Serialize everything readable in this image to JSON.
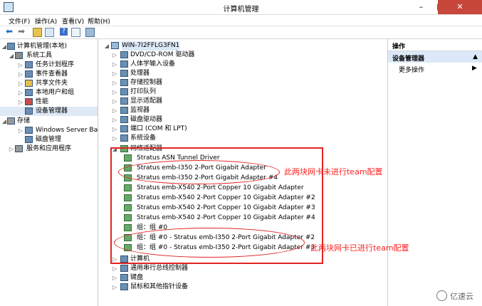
{
  "window": {
    "title": "计算机管理",
    "minimize": "–",
    "maximize": "□",
    "close": "✕"
  },
  "menu": [
    "文件(F)",
    "操作(A)",
    "查看(V)",
    "帮助(H)"
  ],
  "toolbar": [
    "back-icon",
    "forward-icon",
    "up-icon",
    "properties-icon",
    "help-icon",
    "view-icon",
    "monitor-icon"
  ],
  "left_tree": [
    {
      "label": "计算机管理(本地)",
      "level": 0,
      "expanded": true
    },
    {
      "label": "系统工具",
      "level": 1,
      "expanded": true
    },
    {
      "label": "任务计划程序",
      "level": 2
    },
    {
      "label": "事件查看器",
      "level": 2
    },
    {
      "label": "共享文件夹",
      "level": 2
    },
    {
      "label": "本地用户和组",
      "level": 2
    },
    {
      "label": "性能",
      "level": 2
    },
    {
      "label": "设备管理器",
      "level": 2,
      "selected": true
    },
    {
      "label": "存储",
      "level": 1,
      "expanded": true
    },
    {
      "label": "Windows Server Back",
      "level": 2
    },
    {
      "label": "磁盘管理",
      "level": 2
    },
    {
      "label": "服务和应用程序",
      "level": 1
    }
  ],
  "center": {
    "computer": "WIN-7I2FFLG3FN1",
    "categories": [
      "DVD/CD-ROM 驱动器",
      "人体学输入设备",
      "处理器",
      "存储控制器",
      "打印队列",
      "显示适配器",
      "监视器",
      "磁盘驱动器",
      "端口 (COM 和 LPT)",
      "系统设备"
    ],
    "network_adapters_label": "网络适配器",
    "adapters": [
      "Stratus ASN Tunnel Driver",
      "Stratus emb-I350 2-Port Gigabit Adapter",
      "Stratus emb-I350 2-Port Gigabit Adapter #4",
      "Stratus emb-X540 2-Port Copper 10 Gigabit Adapter",
      "Stratus emb-X540 2-Port Copper 10 Gigabit Adapter #2",
      "Stratus emb-X540 2-Port Copper 10 Gigabit Adapter #3",
      "Stratus emb-X540 2-Port Copper 10 Gigabit Adapter #4",
      "组：组 #0",
      "组：组 #0 - Stratus emb-I350 2-Port Gigabit Adapter #2",
      "组：组 #0 - Stratus emb-I350 2-Port Gigabit Adapter #3"
    ],
    "after": [
      "计算机",
      "通用串行总线控制器",
      "键盘",
      "鼠标和其他指针设备"
    ]
  },
  "actions": {
    "header": "操作",
    "section": "设备管理器",
    "more": "更多操作",
    "more_arrow": "▶"
  },
  "notes": {
    "not_teamed": "此两块网卡未进行team配置",
    "teamed": "此两块网卡已进行team配置"
  },
  "watermark": "亿速云"
}
